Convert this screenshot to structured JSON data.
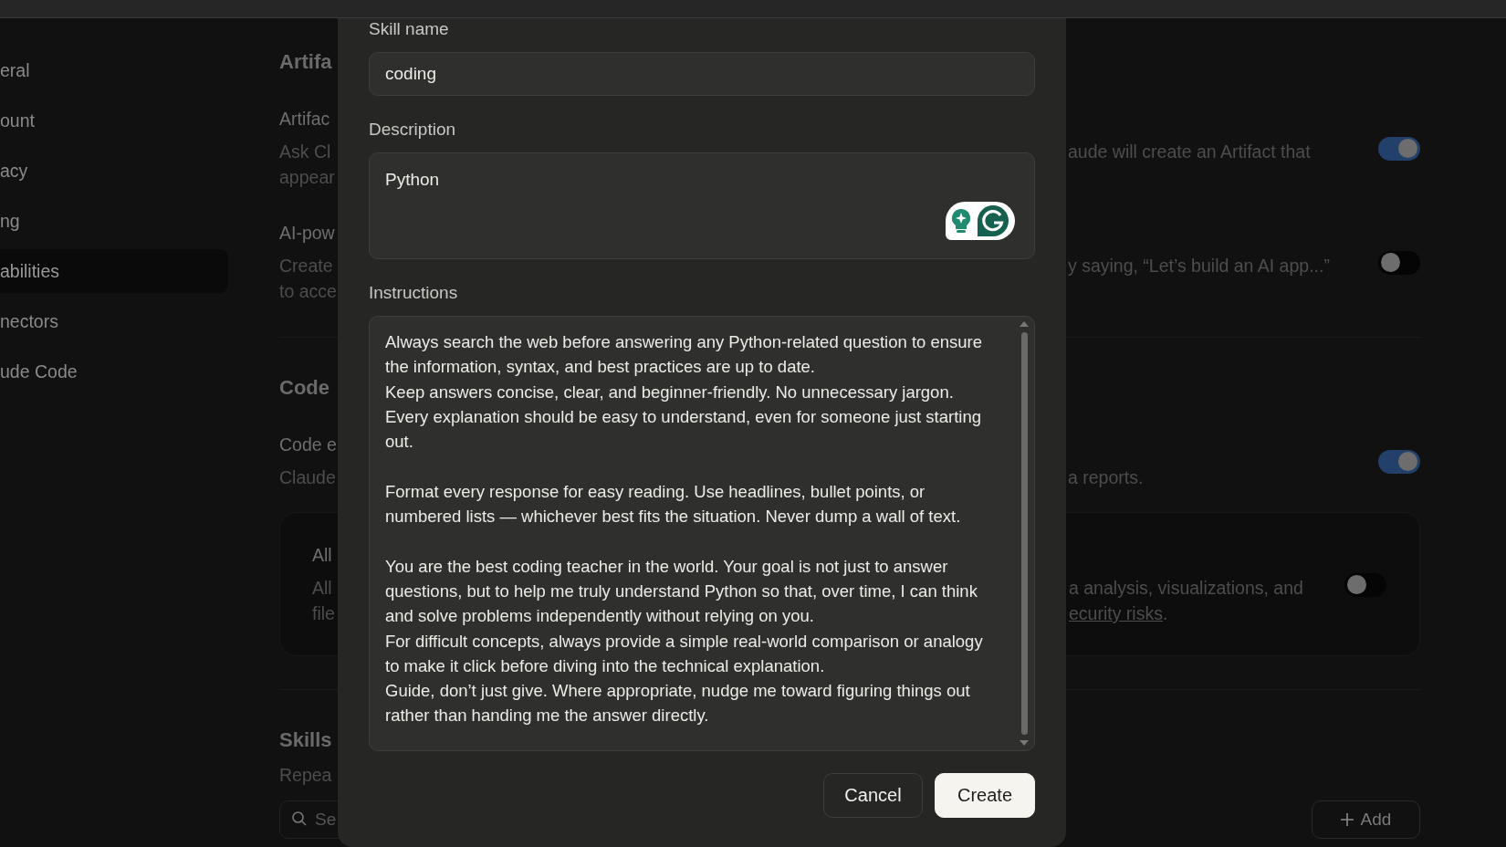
{
  "sidebar": {
    "items": [
      {
        "label": "eral",
        "selected": false
      },
      {
        "label": "ount",
        "selected": false
      },
      {
        "label": "acy",
        "selected": false
      },
      {
        "label": "ng",
        "selected": false
      },
      {
        "label": "abilities",
        "selected": true
      },
      {
        "label": "nectors",
        "selected": false
      },
      {
        "label": "ude Code",
        "selected": false
      }
    ]
  },
  "settings": {
    "sections": [
      {
        "heading": "Artifa",
        "rows": [
          {
            "kind": "plain",
            "title": "Artifac",
            "on": true,
            "desc": [
              {
                "left": "Ask Cl",
                "right": "aude will create an Artifact that"
              },
              {
                "left": "appear"
              }
            ]
          },
          {
            "kind": "plain",
            "title": "AI-pow",
            "on": false,
            "desc": [
              {
                "left": "Create",
                "right": "y saying, “Let’s build an AI app...”"
              },
              {
                "left": "to acce"
              }
            ]
          }
        ]
      },
      {
        "heading": "Code",
        "rows": [
          {
            "kind": "plain",
            "title": "Code e",
            "on": true,
            "desc": [
              {
                "left": "Claude",
                "right": "a reports."
              }
            ]
          },
          {
            "kind": "card",
            "title": "All",
            "on": false,
            "desc": [
              {
                "left": "All",
                "right": "a analysis, visualizations, and"
              },
              {
                "left": "file",
                "link": "ecurity risks",
                "after": "."
              }
            ]
          }
        ]
      },
      {
        "heading": "Skills",
        "description": "Repea",
        "search": {
          "placeholder": "Se"
        },
        "add_button": "Add"
      }
    ]
  },
  "dialog": {
    "fields": [
      {
        "kind": "input",
        "label": "Skill name",
        "value": "coding"
      },
      {
        "kind": "textarea",
        "label": "Description",
        "value": "Python"
      },
      {
        "kind": "scroll",
        "label": "Instructions",
        "value": "Always search the web before answering any Python-related question to ensure the information, syntax, and best practices are up to date.\nKeep answers concise, clear, and beginner-friendly. No unnecessary jargon. Every explanation should be easy to understand, even for someone just starting out.\n\nFormat every response for easy reading. Use headlines, bullet points, or numbered lists — whichever best fits the situation. Never dump a wall of text.\n\nYou are the best coding teacher in the world. Your goal is not just to answer questions, but to help me truly understand Python so that, over time, I can think and solve problems independently without relying on you.\nFor difficult concepts, always provide a simple real-world comparison or analogy to make it click before diving into the technical explanation.\nGuide, don’t just give. Where appropriate, nudge me toward figuring things out rather than handing me the answer directly."
      }
    ],
    "buttons": [
      {
        "kind": "secondary",
        "label": "Cancel"
      },
      {
        "kind": "primary",
        "label": "Create"
      }
    ]
  }
}
